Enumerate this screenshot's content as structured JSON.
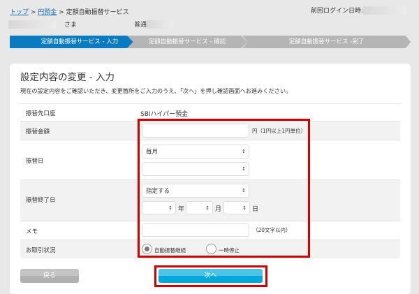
{
  "breadcrumb": {
    "top": "トップ",
    "yen": "円預金",
    "current": "定額自動振替サービス",
    "sep": " > "
  },
  "header": {
    "last_login_label": "前回ログイン日時:",
    "name_suffix": "さま",
    "account_type": "普通"
  },
  "steps": [
    {
      "label": "定額自動振替サービス - 入力",
      "active": true
    },
    {
      "label": "定額自動振替サービス - 確認",
      "active": false
    },
    {
      "label": "定額自動振替サービス -完了",
      "active": false
    }
  ],
  "colors": {
    "accent": "#0a7bc0",
    "highlight": "#d40000",
    "step_inactive": "#b5b5b5"
  },
  "main": {
    "title": "設定内容の変更 - 入力",
    "description": "現在の設定内容をご確認いただき、変更箇所をご入力のうえ、「次へ」を押し確認画面へお進みください。"
  },
  "form": {
    "destination": {
      "label": "振替先口座",
      "value": "SBIハイパー預金"
    },
    "amount": {
      "label": "振替金額",
      "value": "",
      "unit": "円（1円以上1円単位）"
    },
    "date": {
      "label": "振替日",
      "select1": "毎月",
      "select2": ""
    },
    "end_date": {
      "label": "振替終了日",
      "select": "指定する",
      "year_unit": "年",
      "month_unit": "月",
      "day_unit": "日"
    },
    "memo": {
      "label": "メモ",
      "value": "",
      "hint": "（20文字以内）"
    },
    "status": {
      "label": "お取引状況",
      "options": [
        {
          "label": "自動振替継続",
          "selected": true
        },
        {
          "label": "一時停止",
          "selected": false
        }
      ]
    }
  },
  "buttons": {
    "back": "戻る",
    "next": "次へ"
  }
}
